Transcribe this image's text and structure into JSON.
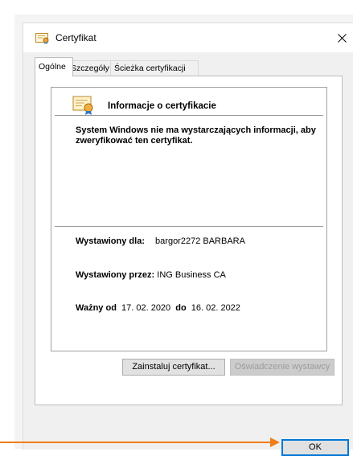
{
  "window": {
    "title": "Certyfikat",
    "close_glyph": "✕"
  },
  "tabs": [
    {
      "label": "Ogólne",
      "active": true
    },
    {
      "label": "Szczegóły",
      "active": false
    },
    {
      "label": "Ścieżka certyfikacji",
      "active": false
    }
  ],
  "info": {
    "title": "Informacje o certyfikacie",
    "message": "System Windows nie ma wystarczających informacji, aby zweryfikować ten certyfikat.",
    "issued_to_label": "Wystawiony dla:",
    "issued_to_value": "bargor2272  BARBARA",
    "issued_by_label": "Wystawiony przez:",
    "issued_by_value": "ING Business CA",
    "valid_from_label": "Ważny od",
    "valid_from_value": "17. 02. 2020",
    "valid_to_label": "do",
    "valid_to_value": "16. 02. 2022"
  },
  "buttons": {
    "install": "Zainstaluj certyfikat...",
    "issuer_statement": "Oświadczenie wystawcy",
    "ok": "OK"
  },
  "colors": {
    "annotation_arrow": "#f07d1a",
    "focus_border": "#0078d7"
  },
  "icons": {
    "window": "certificate-icon",
    "info": "certificate-icon",
    "close": "close-icon"
  }
}
